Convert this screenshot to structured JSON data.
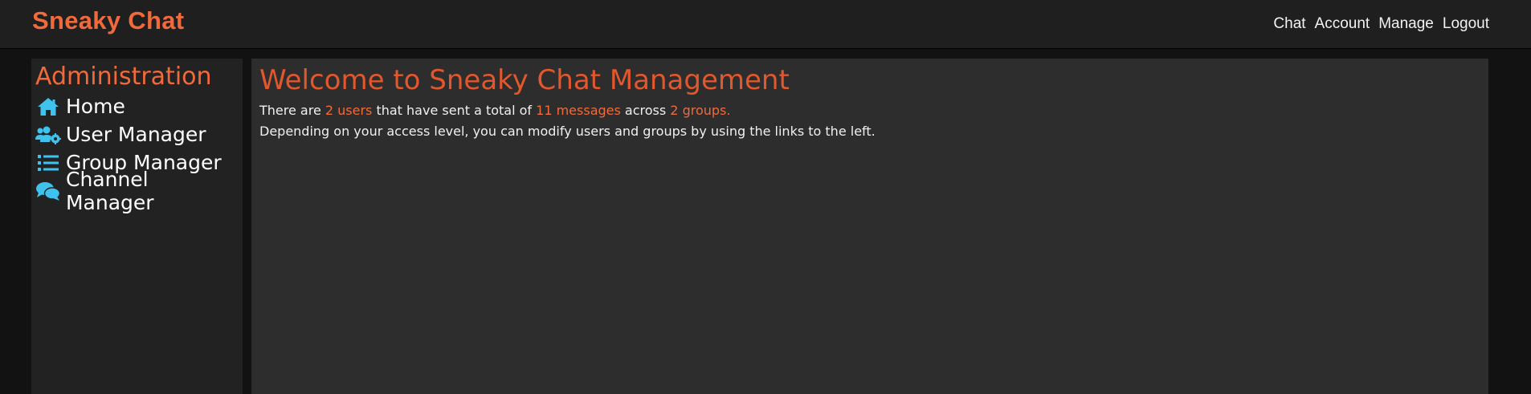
{
  "header": {
    "brand": "Sneaky Chat",
    "nav": [
      "Chat",
      "Account",
      "Manage",
      "Logout"
    ]
  },
  "sidebar": {
    "title": "Administration",
    "items": [
      {
        "label": "Home",
        "icon": "home-icon"
      },
      {
        "label": "User Manager",
        "icon": "users-cog-icon"
      },
      {
        "label": "Group Manager",
        "icon": "list-icon"
      },
      {
        "label": "Channel Manager",
        "icon": "comments-icon"
      }
    ]
  },
  "main": {
    "title": "Welcome to Sneaky Chat Management",
    "stats": {
      "prefix": "There are ",
      "users": "2 users",
      "middle": " that have sent a total of ",
      "messages": "11 messages",
      "across": " across ",
      "groups": "2 groups."
    },
    "description": "Depending on your access level, you can modify users and groups by using the links to the left."
  },
  "colors": {
    "accent": "#f06a3c",
    "title": "#e2572c",
    "icon": "#3fc3ee",
    "header_bg": "#1f1f1f",
    "sidebar_bg": "#222222",
    "main_bg": "#2d2d2d",
    "page_bg": "#121212"
  }
}
